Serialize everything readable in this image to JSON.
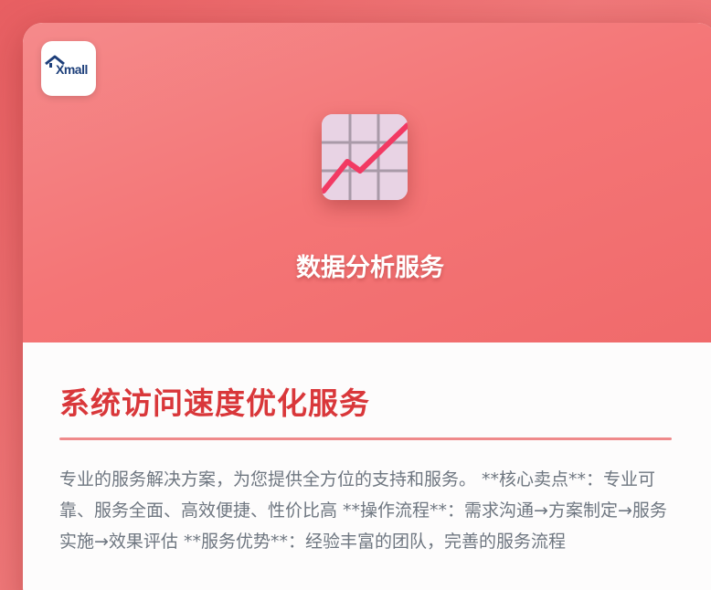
{
  "logo": {
    "text": "Xmall",
    "icon": "house-logo-icon"
  },
  "hero": {
    "icon": "line-chart-grid-icon",
    "title": "数据分析服务"
  },
  "content": {
    "title": "系统访问速度优化服务",
    "description": "专业的服务解决方案，为您提供全方位的支持和服务。 **核心卖点**：专业可靠、服务全面、高效便捷、性价比高 **操作流程**：需求沟通→方案制定→服务实施→效果评估 **服务优势**：经验丰富的团队，完善的服务流程"
  },
  "colors": {
    "background": "#ee6b6c",
    "title_red": "#d9373a",
    "divider": "#ef8a8b",
    "chart_line": "#f23a63",
    "chart_tile": "#e8d3e4",
    "logo_blue": "#1d3f7a"
  }
}
